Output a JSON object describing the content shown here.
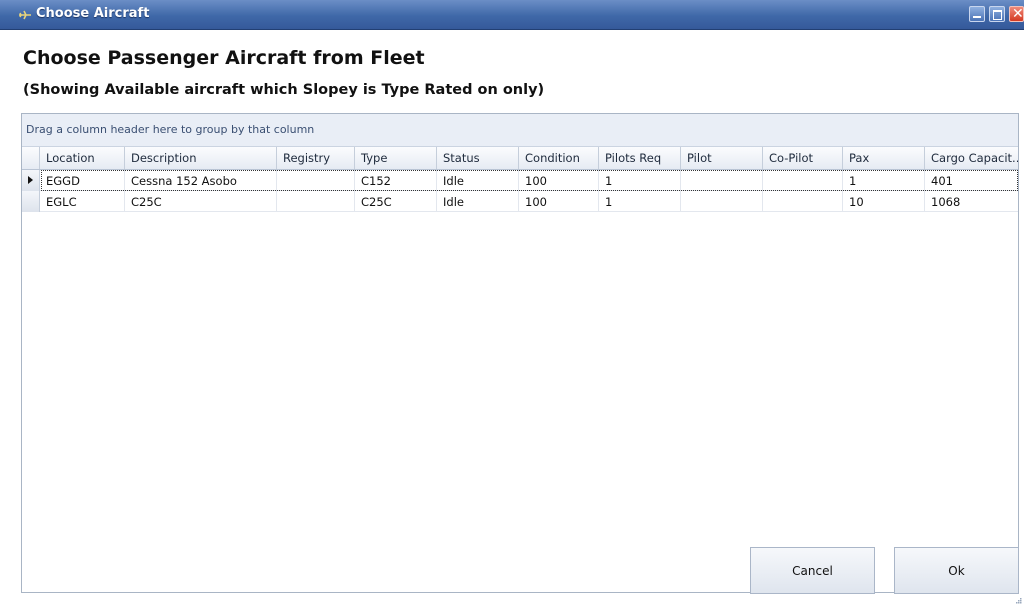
{
  "window": {
    "title": "Choose Aircraft"
  },
  "heading": "Choose Passenger Aircraft from Fleet",
  "subheading": "(Showing Available aircraft which Slopey is Type Rated on only)",
  "grid": {
    "group_hint": "Drag a column header here to group by that column",
    "columns": [
      "Location",
      "Description",
      "Registry",
      "Type",
      "Status",
      "Condition",
      "Pilots Req",
      "Pilot",
      "Co-Pilot",
      "Pax",
      "Cargo Capacit..."
    ],
    "rows": [
      [
        "EGGD",
        "Cessna 152 Asobo",
        "",
        "C152",
        "Idle",
        "100",
        "1",
        "",
        "",
        "1",
        "401"
      ],
      [
        "EGLC",
        "C25C",
        "",
        "C25C",
        "Idle",
        "100",
        "1",
        "",
        "",
        "10",
        "1068"
      ]
    ]
  },
  "buttons": {
    "cancel": "Cancel",
    "ok": "Ok"
  },
  "icons": {
    "app": "aircraft-icon",
    "minimize": "minimize-icon",
    "maximize": "maximize-icon",
    "close": "close-icon"
  },
  "colors": {
    "titlebar": "#3f68a8",
    "group_panel": "#e9eef6"
  }
}
